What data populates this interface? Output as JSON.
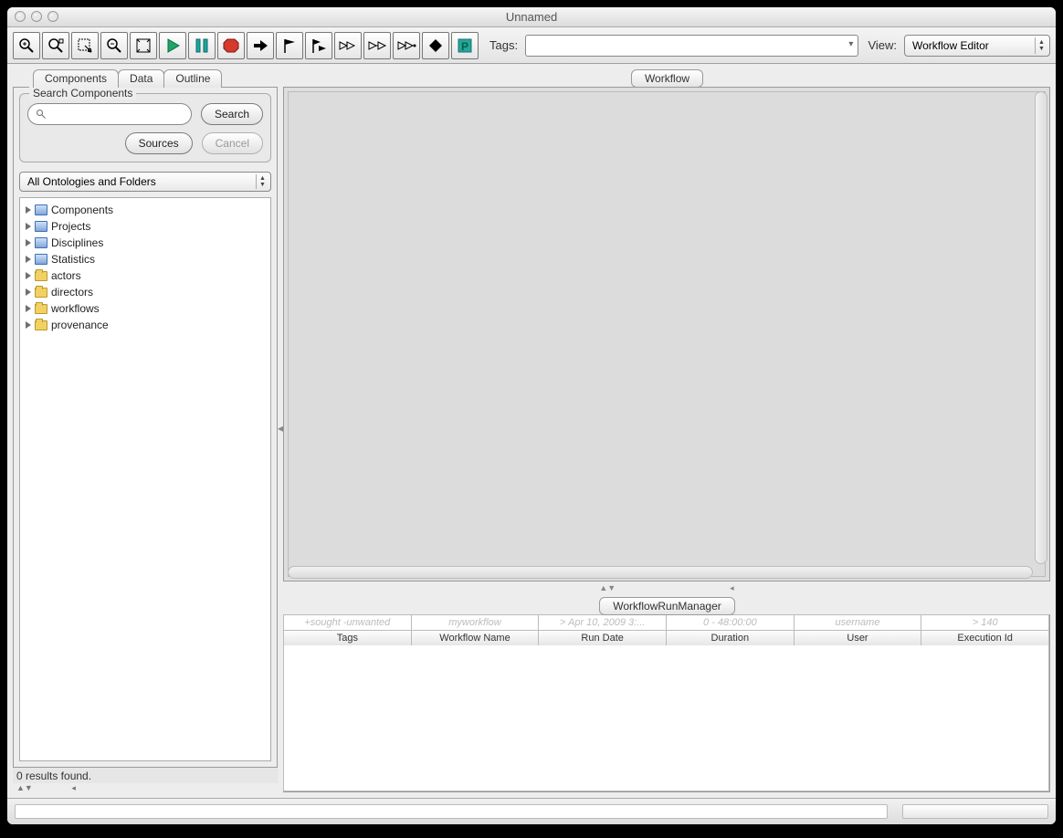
{
  "window": {
    "title": "Unnamed"
  },
  "toolbar": {
    "tags_label": "Tags:",
    "tags_value": "",
    "view_label": "View:",
    "view_value": "Workflow Editor"
  },
  "left": {
    "tabs": [
      {
        "label": "Components",
        "active": true
      },
      {
        "label": "Data",
        "active": false
      },
      {
        "label": "Outline",
        "active": false
      }
    ],
    "search": {
      "legend": "Search Components",
      "query": "",
      "search_btn": "Search",
      "sources_btn": "Sources",
      "cancel_btn": "Cancel"
    },
    "ontology_combo": "All Ontologies and Folders",
    "tree": [
      {
        "label": "Components",
        "icon": "blue"
      },
      {
        "label": "Projects",
        "icon": "blue"
      },
      {
        "label": "Disciplines",
        "icon": "blue"
      },
      {
        "label": "Statistics",
        "icon": "blue"
      },
      {
        "label": "actors",
        "icon": "folder"
      },
      {
        "label": "directors",
        "icon": "folder"
      },
      {
        "label": "workflows",
        "icon": "folder"
      },
      {
        "label": "provenance",
        "icon": "folder"
      }
    ],
    "results_text": "0 results found."
  },
  "right": {
    "workflow_tab": "Workflow",
    "runmgr_tab": "WorkflowRunManager",
    "run_table": {
      "filters": [
        "+sought -unwanted",
        "myworkflow",
        "> Apr 10, 2009 3:...",
        "0 - 48:00:00",
        "username",
        "> 140"
      ],
      "headers": [
        "Tags",
        "Workflow Name",
        "Run Date",
        "Duration",
        "User",
        "Execution Id"
      ]
    }
  }
}
